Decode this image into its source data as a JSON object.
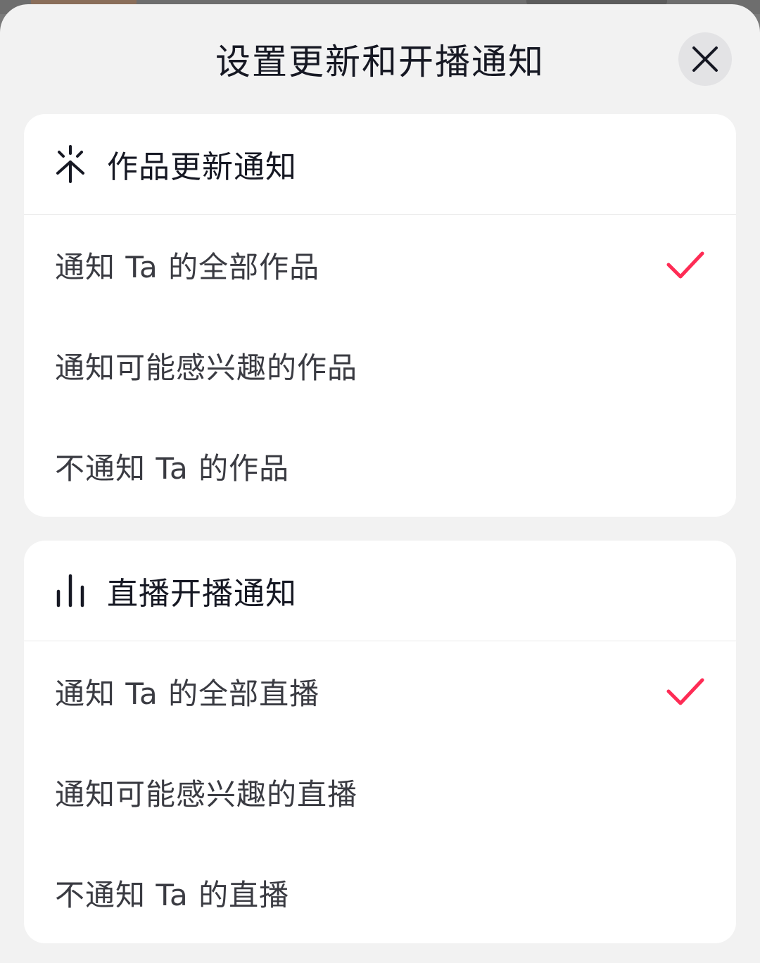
{
  "sheet": {
    "title": "设置更新和开播通知",
    "close_icon": "close-icon"
  },
  "works_section": {
    "header_icon": "sparkle-icon",
    "header_label": "作品更新通知",
    "options": [
      {
        "label": "通知 Ta 的全部作品",
        "selected": true
      },
      {
        "label": "通知可能感兴趣的作品",
        "selected": false
      },
      {
        "label": "不通知 Ta 的作品",
        "selected": false
      }
    ]
  },
  "live_section": {
    "header_icon": "live-bars-icon",
    "header_label": "直播开播通知",
    "options": [
      {
        "label": "通知 Ta 的全部直播",
        "selected": true
      },
      {
        "label": "通知可能感兴趣的直播",
        "selected": false
      },
      {
        "label": "不通知 Ta 的直播",
        "selected": false
      }
    ]
  },
  "colors": {
    "accent_check": "#fe2c55",
    "text_primary": "#161823",
    "sheet_bg": "#f2f2f2",
    "card_bg": "#ffffff"
  }
}
